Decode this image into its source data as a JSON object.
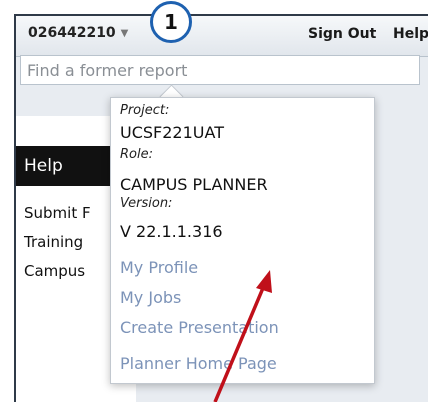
{
  "header": {
    "account_id": "026442210",
    "sign_out": "Sign Out",
    "help": "Help"
  },
  "search": {
    "placeholder": "Find a former report"
  },
  "left_panel": {
    "heading": "Help",
    "links": [
      "Submit F",
      "Training",
      "Campus"
    ]
  },
  "dropdown": {
    "project_label": "Project:",
    "project_value": "UCSF221UAT",
    "role_label": "Role:",
    "role_value": "CAMPUS PLANNER",
    "version_label": "Version:",
    "version_value": "V 22.1.1.316",
    "links": [
      "My Profile",
      "My Jobs",
      "Create Presentation",
      "Planner Home Page"
    ]
  },
  "annotation": {
    "callout_number": "1",
    "arrow_color": "#c0101a",
    "callout_color": "#1e61b0"
  }
}
